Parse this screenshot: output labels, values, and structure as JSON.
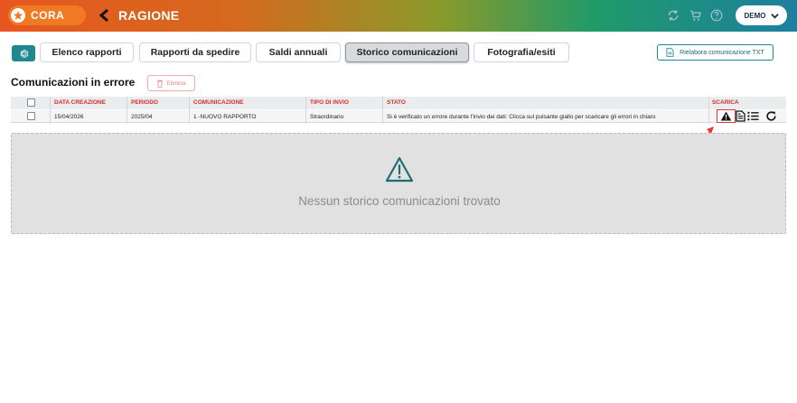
{
  "header": {
    "logo_text": "CORA",
    "app_title": "RAGIONE",
    "user_label": "DEMO",
    "icons": [
      "refresh-icon",
      "cart-icon",
      "help-icon"
    ]
  },
  "tabs": [
    {
      "label": "Elenco rapporti",
      "active": false
    },
    {
      "label": "Rapporti da spedire",
      "active": false
    },
    {
      "label": "Saldi annuali",
      "active": false
    },
    {
      "label": "Storico comunicazioni",
      "active": true
    },
    {
      "label": "Fotografia/esiti",
      "active": false
    }
  ],
  "rielabora_label": "Rielabora comunicazione TXT",
  "section": {
    "title": "Comunicazioni in errore",
    "delete_label": "Elimina"
  },
  "table": {
    "columns": [
      "DATA CREAZIONE",
      "PERIODO",
      "COMUNICAZIONE",
      "TIPO DI INVIO",
      "STATO",
      "SCARICA"
    ],
    "rows": [
      {
        "data_creazione": "15/04/2026",
        "periodo": "2025/04",
        "comunicazione": "1 -NUOVO RAPPORTO",
        "tipo_invio": "Straordinario",
        "stato": "Si è verificato un errore durante l'invio dei dati: Clicca sul pulsante giallo per scaricare gli errori in chiaro"
      }
    ],
    "row_actions": [
      "warning-icon",
      "document-icon",
      "list-icon",
      "reload-icon"
    ]
  },
  "empty_state": {
    "message": "Nessun storico comunicazioni trovato"
  },
  "colors": {
    "accent": "#1e8a8f",
    "header_red": "#d32f2f",
    "annotation": "#e53935"
  }
}
